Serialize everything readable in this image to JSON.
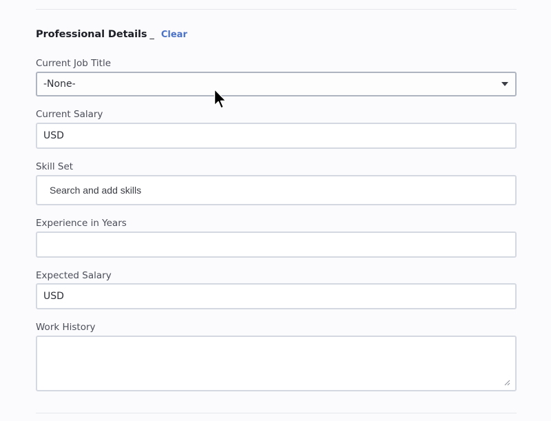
{
  "section": {
    "title": "Professional Details",
    "title_suffix": "_",
    "clear_label": "Clear"
  },
  "fields": {
    "job_title": {
      "label": "Current Job Title",
      "value": "-None-"
    },
    "current_salary": {
      "label": "Current Salary",
      "value": "USD"
    },
    "skill_set": {
      "label": "Skill Set",
      "placeholder": "Search and add skills"
    },
    "experience": {
      "label": "Experience in Years",
      "value": ""
    },
    "expected_salary": {
      "label": "Expected Salary",
      "value": "USD"
    },
    "work_history": {
      "label": "Work History",
      "value": ""
    }
  },
  "icons": {
    "dropdown": "chevron-down-icon",
    "resize": "resize-handle-icon",
    "cursor": "mouse-pointer-icon"
  },
  "colors": {
    "accent_link": "#4a72c6",
    "field_border": "#d4d8e1",
    "focused_border": "#aeb4c0"
  }
}
